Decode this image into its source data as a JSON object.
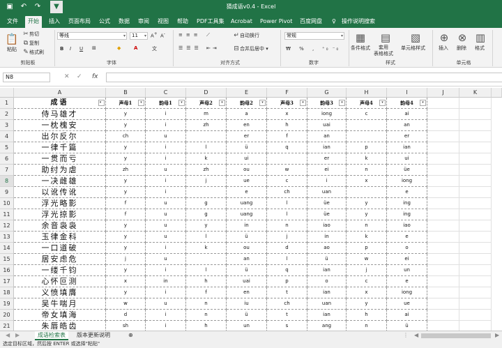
{
  "window": {
    "title": "猜成语v0.4  -  Excel"
  },
  "menu": [
    "文件",
    "开始",
    "插入",
    "页面布局",
    "公式",
    "数据",
    "审阅",
    "视图",
    "帮助",
    "PDF工具集",
    "Acrobat",
    "Power Pivot",
    "百度网盘",
    "操作说明搜索"
  ],
  "ribbon": {
    "clipboard": {
      "paste": "粘贴",
      "cut": "剪切",
      "copy": "复制",
      "format_painter": "格式刷",
      "label": "剪贴板"
    },
    "font": {
      "name": "等线",
      "size": "11",
      "bold": "B",
      "italic": "I",
      "underline": "U",
      "label": "字体"
    },
    "alignment": {
      "wrap": "自动换行",
      "merge": "合并后居中",
      "label": "对齐方式"
    },
    "number": {
      "format": "常规",
      "label": "数字"
    },
    "styles": {
      "conditional": "条件格式",
      "table": "套用\n表格格式",
      "cell_styles": "单元格样式",
      "label": "样式"
    },
    "cells": {
      "insert": "插入",
      "delete": "删除",
      "format": "格式",
      "label": "单元格"
    }
  },
  "formula_bar": {
    "name_box": "N8",
    "fx": "fx"
  },
  "grid": {
    "columns": [
      "A",
      "B",
      "C",
      "D",
      "E",
      "F",
      "G",
      "H",
      "I",
      "J",
      "K"
    ],
    "rows": [
      "1",
      "2",
      "3",
      "4",
      "5",
      "6",
      "7",
      "8",
      "9",
      "10",
      "11",
      "12",
      "13",
      "14",
      "15",
      "16",
      "17",
      "18",
      "19",
      "20",
      "21"
    ],
    "selected_row": "8",
    "headers": [
      "成语",
      "声母1",
      "韵母1",
      "声母2",
      "韵母2",
      "声母3",
      "韵母3",
      "声母4",
      "韵母4"
    ],
    "data": [
      [
        "侍马雄才",
        "y",
        "i",
        "m",
        "a",
        "x",
        "iong",
        "c",
        "ai"
      ],
      [
        "一枕槐安",
        "y",
        "i",
        "zh",
        "en",
        "h",
        "uai",
        "",
        "an"
      ],
      [
        "出尔反尔",
        "ch",
        "u",
        "",
        "er",
        "f",
        "an",
        "",
        "er"
      ],
      [
        "一律千篇",
        "y",
        "i",
        "l",
        "ü",
        "q",
        "ian",
        "p",
        "ian"
      ],
      [
        "一贯而亏",
        "y",
        "i",
        "k",
        "ui",
        "",
        "er",
        "k",
        "ui"
      ],
      [
        "助纣为虐",
        "zh",
        "u",
        "zh",
        "ou",
        "w",
        "ei",
        "n",
        "üe"
      ],
      [
        "一决雌雄",
        "y",
        "i",
        "j",
        "ue",
        "c",
        "i",
        "x",
        "iong"
      ],
      [
        "以讹传讹",
        "y",
        "i",
        "",
        "e",
        "ch",
        "uan",
        "",
        "e"
      ],
      [
        "浮光略影",
        "f",
        "u",
        "g",
        "uang",
        "l",
        "üe",
        "y",
        "ing"
      ],
      [
        "浮光掠影",
        "f",
        "u",
        "g",
        "uang",
        "l",
        "üe",
        "y",
        "ing"
      ],
      [
        "余音袅袅",
        "y",
        "u",
        "y",
        "in",
        "n",
        "iao",
        "n",
        "iao"
      ],
      [
        "玉律金科",
        "y",
        "u",
        "l",
        "ü",
        "j",
        "in",
        "k",
        "e"
      ],
      [
        "一口道破",
        "y",
        "i",
        "k",
        "ou",
        "d",
        "ao",
        "p",
        "o"
      ],
      [
        "居安虑危",
        "j",
        "u",
        "",
        "an",
        "l",
        "ü",
        "w",
        "ei"
      ],
      [
        "一缕千钧",
        "y",
        "i",
        "l",
        "ü",
        "q",
        "ian",
        "j",
        "un"
      ],
      [
        "心怀叵测",
        "x",
        "in",
        "h",
        "uai",
        "p",
        "o",
        "c",
        "e"
      ],
      [
        "义愤填膺",
        "y",
        "i",
        "f",
        "en",
        "t",
        "ian",
        "x",
        "iong"
      ],
      [
        "吴牛喘月",
        "w",
        "u",
        "n",
        "iu",
        "ch",
        "uan",
        "y",
        "ue"
      ],
      [
        "帝女填海",
        "d",
        "i",
        "n",
        "ü",
        "t",
        "ian",
        "h",
        "ai"
      ],
      [
        "朱唇皓齿",
        "sh",
        "i",
        "h",
        "un",
        "s",
        "ang",
        "n",
        "ü"
      ]
    ]
  },
  "sheets": [
    "成语检索表",
    "版本更新说明"
  ],
  "status": "选定目标区域，然后按 ENTER 或选择\"粘贴\""
}
